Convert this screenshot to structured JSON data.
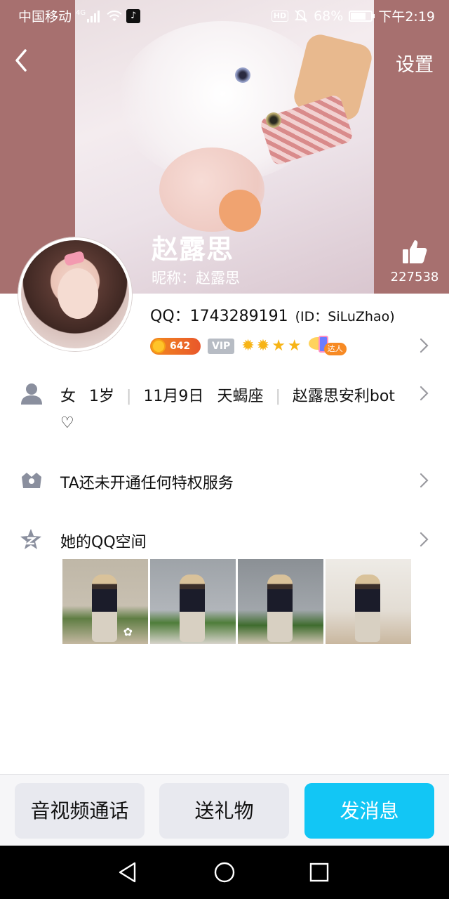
{
  "status_bar": {
    "carrier": "中国移动",
    "network": "4G",
    "hd": "HD",
    "battery": "68%",
    "time": "下午2:19"
  },
  "header": {
    "settings_label": "设置",
    "name": "赵露思",
    "nickname": "昵称：赵露思",
    "likes": "227538"
  },
  "profile": {
    "qq": "QQ：1743289191",
    "id": "(ID：SiLuZhao)",
    "level": "642",
    "vip": "VIP",
    "daren": "达人"
  },
  "info": {
    "gender": "女",
    "age": "1岁",
    "birthday": "11月9日",
    "zodiac": "天蝎座",
    "bio": "赵露思安利bot",
    "bio_cont": "♡"
  },
  "privilege": {
    "text": "TA还未开通任何特权服务"
  },
  "qzone": {
    "title": "她的QQ空间"
  },
  "actions": {
    "call": "音视频通话",
    "gift": "送礼物",
    "message": "发消息"
  },
  "colors": {
    "cover_bg": "#a7706f",
    "primary_button": "#12c6f5",
    "secondary_button": "#e8e9ef",
    "icon_gray": "#8a8f9e"
  }
}
